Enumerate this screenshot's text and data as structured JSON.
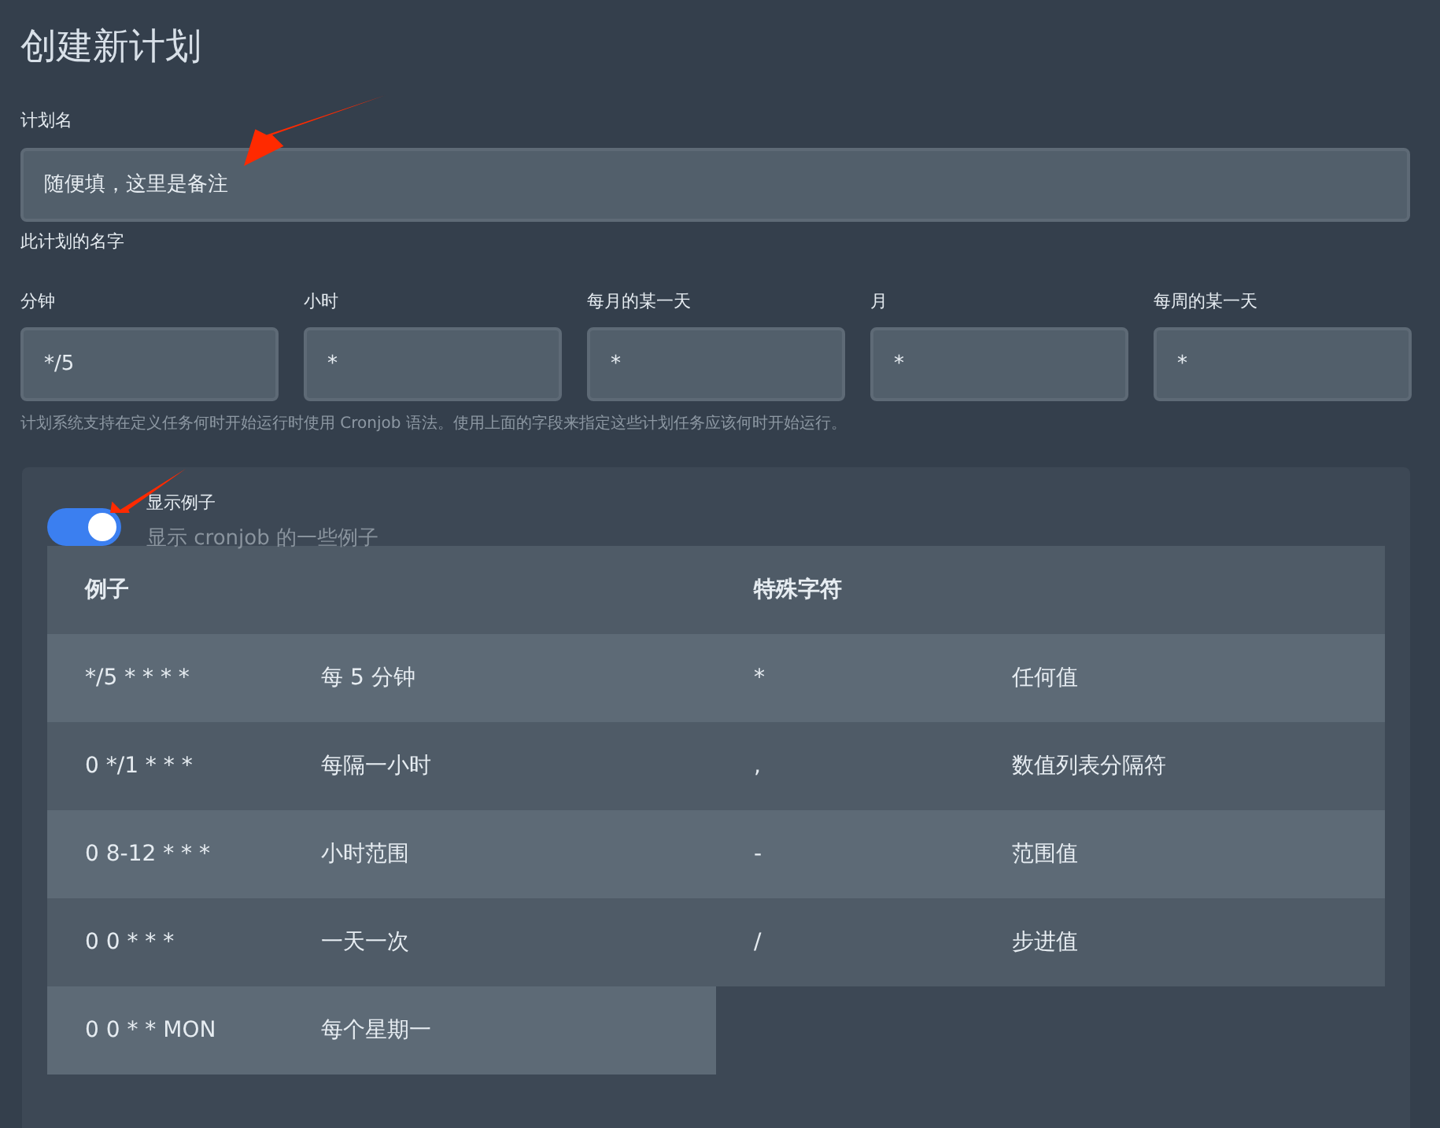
{
  "title": "创建新计划",
  "plan_name": {
    "label": "计划名",
    "value": "随便填，这里是备注",
    "help": "此计划的名字"
  },
  "schedule_fields": [
    {
      "label": "分钟",
      "value": "*/5"
    },
    {
      "label": "小时",
      "value": "*"
    },
    {
      "label": "每月的某一天",
      "value": "*"
    },
    {
      "label": "月",
      "value": "*"
    },
    {
      "label": "每周的某一天",
      "value": "*"
    }
  ],
  "schedule_help": "计划系统支持在定义任务何时开始运行时使用 Cronjob 语法。使用上面的字段来指定这些计划任务应该何时开始运行。",
  "examples_toggle": {
    "on": true,
    "label": "显示例子",
    "description": "显示 cronjob 的一些例子"
  },
  "examples_table": {
    "columns": [
      "例子",
      "特殊字符"
    ],
    "examples": [
      {
        "expr": "*/5 * * * *",
        "meaning": "每 5 分钟"
      },
      {
        "expr": "0 */1 * * *",
        "meaning": "每隔一小时"
      },
      {
        "expr": "0 8-12 * * *",
        "meaning": "小时范围"
      },
      {
        "expr": "0 0 * * *",
        "meaning": "一天一次"
      },
      {
        "expr": "0 0 * * MON",
        "meaning": "每个星期一"
      }
    ],
    "special_chars": [
      {
        "char": "*",
        "meaning": "任何值"
      },
      {
        "char": ",",
        "meaning": "数值列表分隔符"
      },
      {
        "char": "-",
        "meaning": "范围值"
      },
      {
        "char": "/",
        "meaning": "步进值"
      }
    ]
  }
}
